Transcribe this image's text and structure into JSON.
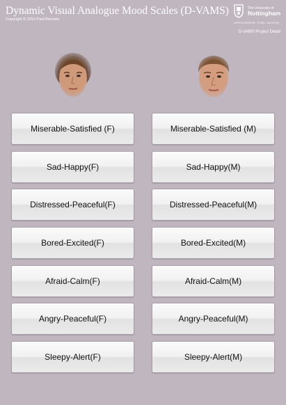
{
  "header": {
    "title": "Dynamic Visual Analogue Mood Scales (D-VAMS)",
    "copyright": "Copyright © 2013 Paul Barrows"
  },
  "logo": {
    "small_text": "The University of",
    "name": "Nottingham",
    "tagline": "UNITED KINGDOM · CHINA · MALAYSIA",
    "icon": "university-crest-icon"
  },
  "project_link": "D-VAMS Project Detail",
  "faces": {
    "female_icon": "female-face-icon",
    "male_icon": "male-face-icon"
  },
  "scales": {
    "female": [
      "Miserable-Satisfied (F)",
      "Sad-Happy(F)",
      "Distressed-Peaceful(F)",
      "Bored-Excited(F)",
      "Afraid-Calm(F)",
      "Angry-Peaceful(F)",
      "Sleepy-Alert(F)"
    ],
    "male": [
      "Miserable-Satisfied (M)",
      "Sad-Happy(M)",
      "Distressed-Peaceful(M)",
      "Bored-Excited(M)",
      "Afraid-Calm(M)",
      "Angry-Peaceful(M)",
      "Sleepy-Alert(M)"
    ]
  },
  "colors": {
    "background": "#c0b6c0",
    "button_text": "#111111",
    "header_text": "#ffffff"
  }
}
